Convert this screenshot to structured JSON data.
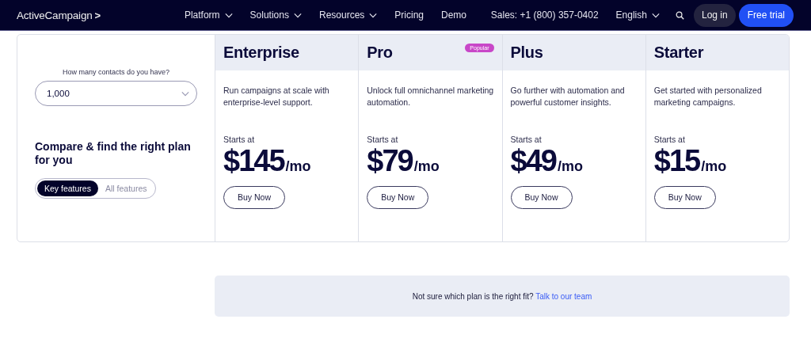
{
  "nav": {
    "logo": "ActiveCampaign",
    "logo_mark": ">",
    "menu": [
      {
        "label": "Platform",
        "dropdown": true
      },
      {
        "label": "Solutions",
        "dropdown": true
      },
      {
        "label": "Resources",
        "dropdown": true
      },
      {
        "label": "Pricing",
        "dropdown": false
      },
      {
        "label": "Demo",
        "dropdown": false
      }
    ],
    "sales": "Sales: +1 (800) 357-0402",
    "language": "English",
    "login": "Log in",
    "cta": "Free trial"
  },
  "sidebar": {
    "contacts_label": "How many contacts do you have?",
    "contacts_value": "1,000",
    "heading": "Compare & find the right plan for you",
    "toggle": [
      {
        "label": "Key features",
        "selected": true
      },
      {
        "label": "All features",
        "selected": false
      }
    ]
  },
  "plans": [
    {
      "name": "Enterprise",
      "description": "Run campaigns at scale with enterprise-level support.",
      "starts": "Starts at",
      "price": "$145",
      "period": "/mo",
      "button": "Buy Now"
    },
    {
      "name": "Pro",
      "badge": "Popular",
      "description": "Unlock full omnichannel marketing automation.",
      "starts": "Starts at",
      "price": "$79",
      "period": "/mo",
      "button": "Buy Now"
    },
    {
      "name": "Plus",
      "description": "Go further with automation and powerful customer insights.",
      "starts": "Starts at",
      "price": "$49",
      "period": "/mo",
      "button": "Buy Now"
    },
    {
      "name": "Starter",
      "description": "Get started with personalized marketing campaigns.",
      "starts": "Starts at",
      "price": "$15",
      "period": "/mo",
      "button": "Buy Now"
    }
  ],
  "help": {
    "text": "Not sure which plan is the right fit?",
    "link": "Talk to our team"
  }
}
